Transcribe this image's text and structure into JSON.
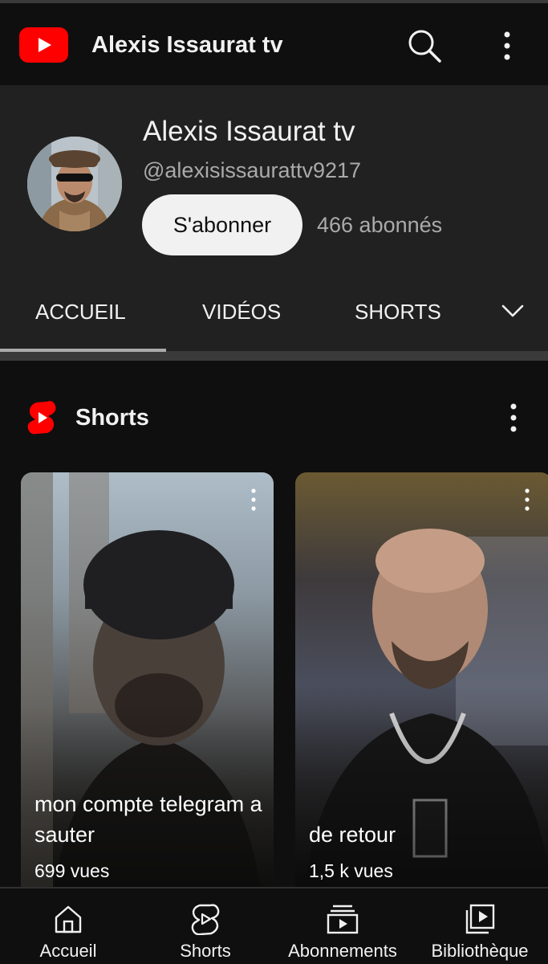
{
  "topbar": {
    "logo_icon": "youtube-logo-icon",
    "title": "Alexis Issaurat tv",
    "search_icon": "search-icon",
    "more_icon": "more-vertical-icon"
  },
  "channel": {
    "name": "Alexis Issaurat tv",
    "handle": "@alexisissaurattv9217",
    "subscribe_label": "S'abonner",
    "subscriber_count": "466 abonnés",
    "avatar_icon": "avatar"
  },
  "tabs": {
    "items": [
      {
        "label": "ACCUEIL",
        "selected": true
      },
      {
        "label": "VIDÉOS",
        "selected": false
      },
      {
        "label": "SHORTS",
        "selected": false
      }
    ],
    "more_icon": "chevron-down-icon"
  },
  "shorts": {
    "heading": "Shorts",
    "icon": "shorts-icon",
    "cards": [
      {
        "title": "mon compte telegram a sauter",
        "views": "699 vues"
      },
      {
        "title": "de retour",
        "views": "1,5 k vues"
      }
    ]
  },
  "bottom_nav": {
    "items": [
      {
        "label": "Accueil",
        "icon": "home-icon"
      },
      {
        "label": "Shorts",
        "icon": "shorts-icon"
      },
      {
        "label": "Abonnements",
        "icon": "subscriptions-icon"
      },
      {
        "label": "Bibliothèque",
        "icon": "library-icon"
      }
    ]
  },
  "colors": {
    "background": "#0f0f0f",
    "header_background": "#212121",
    "brand_red": "#ff0000",
    "text_primary": "#f1f1f1",
    "text_secondary": "#aaaaaa",
    "button_background": "#f1f1f1"
  }
}
